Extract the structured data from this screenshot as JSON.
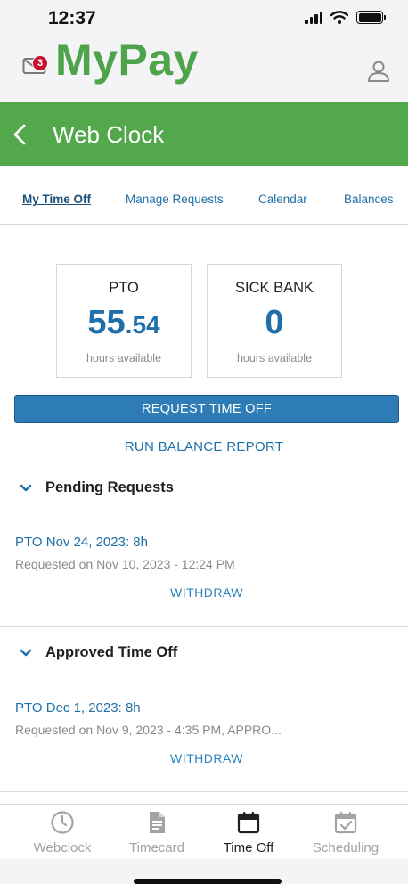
{
  "status_bar": {
    "time": "12:37"
  },
  "app": {
    "title": "MyPay",
    "mail_badge_count": "3",
    "colors": {
      "brand_green": "#52a84a",
      "accent_blue": "#1f6fa8",
      "badge_red": "#c8102e"
    }
  },
  "page": {
    "title": "Web Clock"
  },
  "tabs": [
    {
      "label": "My Time Off",
      "active": true
    },
    {
      "label": "Manage Requests",
      "active": false
    },
    {
      "label": "Calendar",
      "active": false
    },
    {
      "label": "Balances",
      "active": false
    }
  ],
  "balances": [
    {
      "title": "PTO",
      "value_whole": "55",
      "value_frac": ".54",
      "caption": "hours available"
    },
    {
      "title": "SICK BANK",
      "value_whole": "0",
      "value_frac": "",
      "caption": "hours available"
    }
  ],
  "actions": {
    "request_time_off": "REQUEST TIME OFF",
    "run_balance_report": "RUN BALANCE REPORT"
  },
  "pending": {
    "title": "Pending Requests",
    "items": [
      {
        "title": "PTO Nov 24, 2023: 8h",
        "subtitle": "Requested on Nov 10, 2023 - 12:24 PM",
        "action": "WITHDRAW"
      }
    ]
  },
  "approved": {
    "title": "Approved Time Off",
    "items": [
      {
        "title": "PTO Dec 1, 2023: 8h",
        "subtitle": "Requested on Nov 9, 2023 - 4:35 PM, APPRO...",
        "action": "WITHDRAW"
      }
    ]
  },
  "bottom_nav": [
    {
      "label": "Webclock",
      "icon": "clock-icon",
      "active": false
    },
    {
      "label": "Timecard",
      "icon": "document-icon",
      "active": false
    },
    {
      "label": "Time Off",
      "icon": "calendar-icon",
      "active": true
    },
    {
      "label": "Scheduling",
      "icon": "calendar-check-icon",
      "active": false
    }
  ]
}
